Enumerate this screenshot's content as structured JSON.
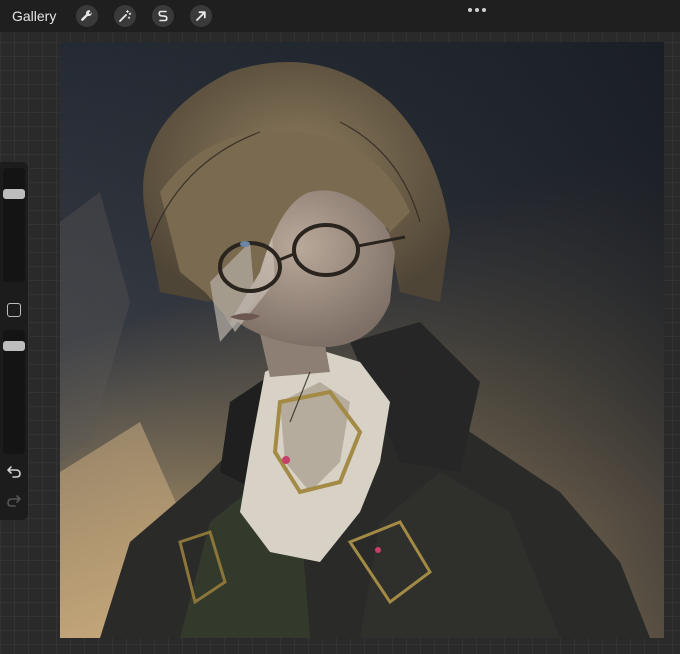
{
  "topbar": {
    "gallery_label": "Gallery",
    "tools": [
      {
        "name": "actions",
        "icon": "wrench-icon"
      },
      {
        "name": "adjustments",
        "icon": "magic-wand-icon"
      },
      {
        "name": "selection",
        "icon": "selection-s-icon"
      },
      {
        "name": "transform",
        "icon": "arrow-cursor-icon"
      }
    ],
    "more_icon": "more-dots-icon"
  },
  "sidebar": {
    "brush_size_level": 0.2,
    "brush_opacity_level": 0.1,
    "modify_icon": "square-modify-icon",
    "undo_icon": "undo-icon",
    "redo_icon": "redo-icon"
  },
  "canvas": {
    "subject": "portrait-painting"
  },
  "colors": {
    "toolbar_bg": "#1f1f1f",
    "canvas_bg": "#1e2229",
    "hair": "#7a6a4f",
    "coat": "#2a2a28",
    "cravat": "#d8d2c6",
    "gold_trim": "#a38a45"
  }
}
